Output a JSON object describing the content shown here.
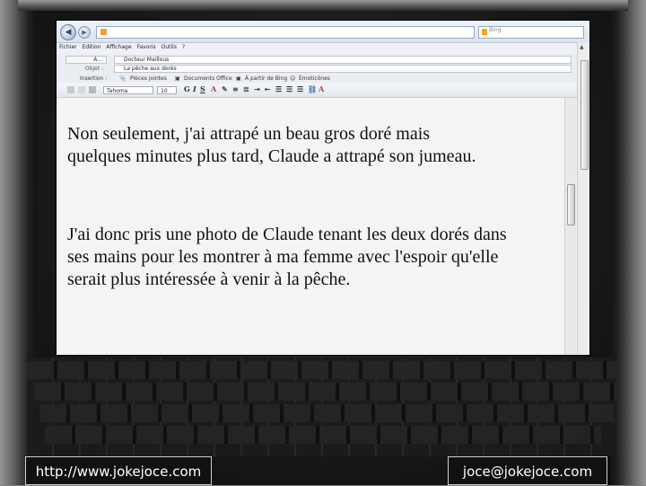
{
  "browser": {
    "search_label": "Bing",
    "menu": [
      "Fichier",
      "Edition",
      "Affichage",
      "Favoris",
      "Outils",
      "?"
    ]
  },
  "compose": {
    "to_button": "À...",
    "to_value": "Docteur Maillous",
    "subject_label": "Objet :",
    "subject_value": "La pêche aux dorés",
    "insert_label": "Insertion :",
    "attachments": "Pièces jointes",
    "office_docs": "Documents Office",
    "from_bing": "À partir de Bing",
    "emoticons": "Émoticônes",
    "font": "Tahoma",
    "size": "10"
  },
  "message": {
    "paragraph1": "Non seulement, j'ai attrapé un beau gros doré mais quelques minutes plus tard, Claude a attrapé son jumeau.",
    "paragraph2": "J'ai donc pris une photo de Claude tenant les deux dorés dans ses mains pour les montrer à ma femme avec l'espoir qu'elle serait plus intéressée à venir à la pêche."
  },
  "footer": {
    "url": "http://www.jokejoce.com",
    "email": "joce@jokejoce.com"
  }
}
